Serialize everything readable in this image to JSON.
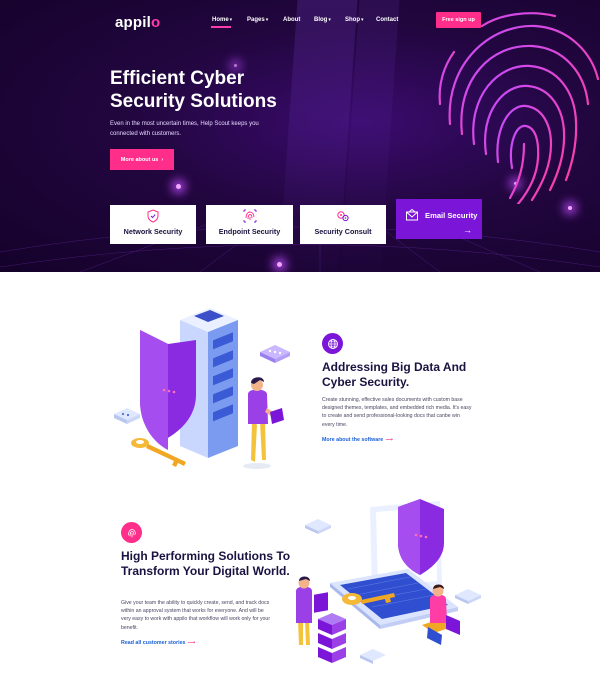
{
  "brand": {
    "name": "appilo",
    "accent": "#ff2e8a",
    "purple": "#7b16d9",
    "hero_bg": "#22063f"
  },
  "nav": {
    "items": [
      {
        "label": "Home",
        "has_dropdown": true,
        "active": true
      },
      {
        "label": "Pages",
        "has_dropdown": true
      },
      {
        "label": "About",
        "has_dropdown": false
      },
      {
        "label": "Blog",
        "has_dropdown": true
      },
      {
        "label": "Shop",
        "has_dropdown": true
      },
      {
        "label": "Contact",
        "has_dropdown": false
      }
    ],
    "caret": "▾",
    "cta": "Free sign up"
  },
  "hero": {
    "title_line1": "Efficient Cyber",
    "title_line2": "Security Solutions",
    "description": "Even in the most uncertain times, Help Scout keeps you connected with customers.",
    "button": "More about us",
    "button_arrow": "›"
  },
  "services": [
    {
      "label": "Network Security",
      "icon": "shield-icon"
    },
    {
      "label": "Endpoint Security",
      "icon": "fingerprint-icon"
    },
    {
      "label": "Security Consult",
      "icon": "gears-icon"
    },
    {
      "label": "Email Security",
      "icon": "envelope-icon",
      "active": true,
      "arrow": "→"
    }
  ],
  "section1": {
    "icon": "globe-icon",
    "title": "Addressing Big Data And Cyber Security.",
    "description": "Create stunning, effective sales documents with custom base designed themes, templates, and embedded rich media. It's easy to create and send professional-looking docs that canbe win every time.",
    "link": "More about the software",
    "link_arrow": "⟶"
  },
  "section2": {
    "icon": "fingerprint-icon",
    "title": "High Performing Solutions To Transform Your Digital World.",
    "description": "Give your team the ability to quickly create, send, and track docs within an approval system that works for everyone. And will be very easy to work with appilo that workflow will work only for your benefit.",
    "link": "Read all customer stories",
    "link_arrow": "⟶"
  }
}
